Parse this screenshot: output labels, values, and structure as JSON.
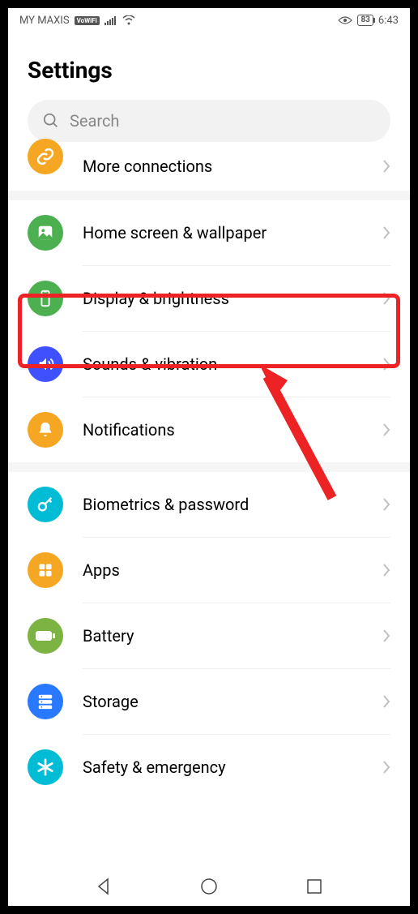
{
  "status_bar": {
    "carrier": "MY MAXIS",
    "vowifi": "VoWiFi",
    "battery_percent": "83",
    "time": "6:43"
  },
  "header": {
    "title": "Settings"
  },
  "search": {
    "placeholder": "Search"
  },
  "groups": [
    {
      "items": [
        {
          "label": "More connections",
          "icon": "link-icon",
          "color": "icon-orange",
          "partial": true
        }
      ]
    },
    {
      "items": [
        {
          "label": "Home screen & wallpaper",
          "icon": "image-icon",
          "color": "icon-green"
        },
        {
          "label": "Display & brightness",
          "icon": "phone-icon",
          "color": "icon-green",
          "highlighted": true
        },
        {
          "label": "Sounds & vibration",
          "icon": "speaker-icon",
          "color": "icon-blue"
        },
        {
          "label": "Notifications",
          "icon": "bell-icon",
          "color": "icon-orange"
        }
      ]
    },
    {
      "items": [
        {
          "label": "Biometrics & password",
          "icon": "key-icon",
          "color": "icon-cyan"
        },
        {
          "label": "Apps",
          "icon": "grid-icon",
          "color": "icon-orange"
        },
        {
          "label": "Battery",
          "icon": "battery-icon",
          "color": "icon-lightgreen"
        },
        {
          "label": "Storage",
          "icon": "storage-icon",
          "color": "icon-indigo"
        },
        {
          "label": "Safety & emergency",
          "icon": "asterisk-icon",
          "color": "icon-cyan",
          "partial_bottom": true
        }
      ]
    }
  ]
}
